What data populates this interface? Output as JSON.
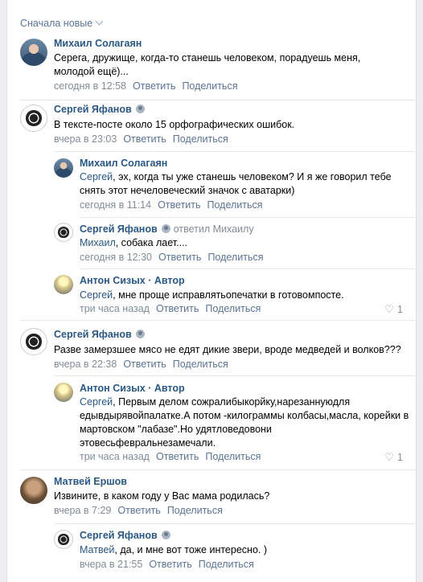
{
  "sort": {
    "label": "Сначала новые"
  },
  "comments": [
    {
      "author": "Михаил Солагаян",
      "text": "Серега, дружище, когда-то станешь человеком, порадуешь меня, молодой ещё)...",
      "time": "сегодня в 12:58",
      "reply": "Ответить",
      "share": "Поделиться"
    },
    {
      "author": "Сергей Яфанов",
      "text": "В тексте-посте около 15 орфографических ошибок.",
      "time": "вчера в 23:03",
      "reply": "Ответить",
      "share": "Поделиться",
      "replies": [
        {
          "author": "Михаил Солагаян",
          "to_name": "Сергей",
          "text": ", эх, когда ты уже станешь человеком? И я же говорил тебе снять этот нечеловеческий значок с аватарки)",
          "time": "сегодня в 11:14",
          "reply": "Ответить",
          "share": "Поделиться"
        },
        {
          "author": "Сергей Яфанов",
          "replied_to": "ответил Михаилу",
          "to_name": "Михаил",
          "text": ", собака лает....",
          "time": "сегодня в 12:30",
          "reply": "Ответить",
          "share": "Поделиться"
        },
        {
          "author": "Антон Сизых · Автор",
          "to_name": "Сергей",
          "text": ", мне проще исправлятьопечатки в готовомпосте.",
          "time": "три часа назад",
          "reply": "Ответить",
          "share": "Поделиться",
          "likes": "1"
        }
      ]
    },
    {
      "author": "Сергей Яфанов",
      "text": "Разве замерзшее мясо не едят дикие звери, вроде медведей и волков???",
      "time": "вчера в 22:38",
      "reply": "Ответить",
      "share": "Поделиться",
      "replies": [
        {
          "author": "Антон Сизых · Автор",
          "to_name": "Сергей",
          "text": ", Первым делом сожралибыкорйку,нарезаннуюдля едывдырявойпалатке.А потом -килограммы колбасы,масла, корейки в мартовском \"лабазе\".Но удятловедовони этовесьфевральнезамечали.",
          "time": "три часа назад",
          "reply": "Ответить",
          "share": "Поделиться",
          "likes": "1"
        }
      ]
    },
    {
      "author": "Матвей Ершов",
      "text": "Извините, в каком году у Вас мама родилась?",
      "time": "вчера в 7:29",
      "reply": "Ответить",
      "share": "Поделиться",
      "replies": [
        {
          "author": "Сергей Яфанов",
          "to_name": "Матвей",
          "text": ", да, и мне вот тоже интересно. )",
          "time": "вчера в 21:55",
          "reply": "Ответить",
          "share": "Поделиться"
        }
      ]
    }
  ]
}
